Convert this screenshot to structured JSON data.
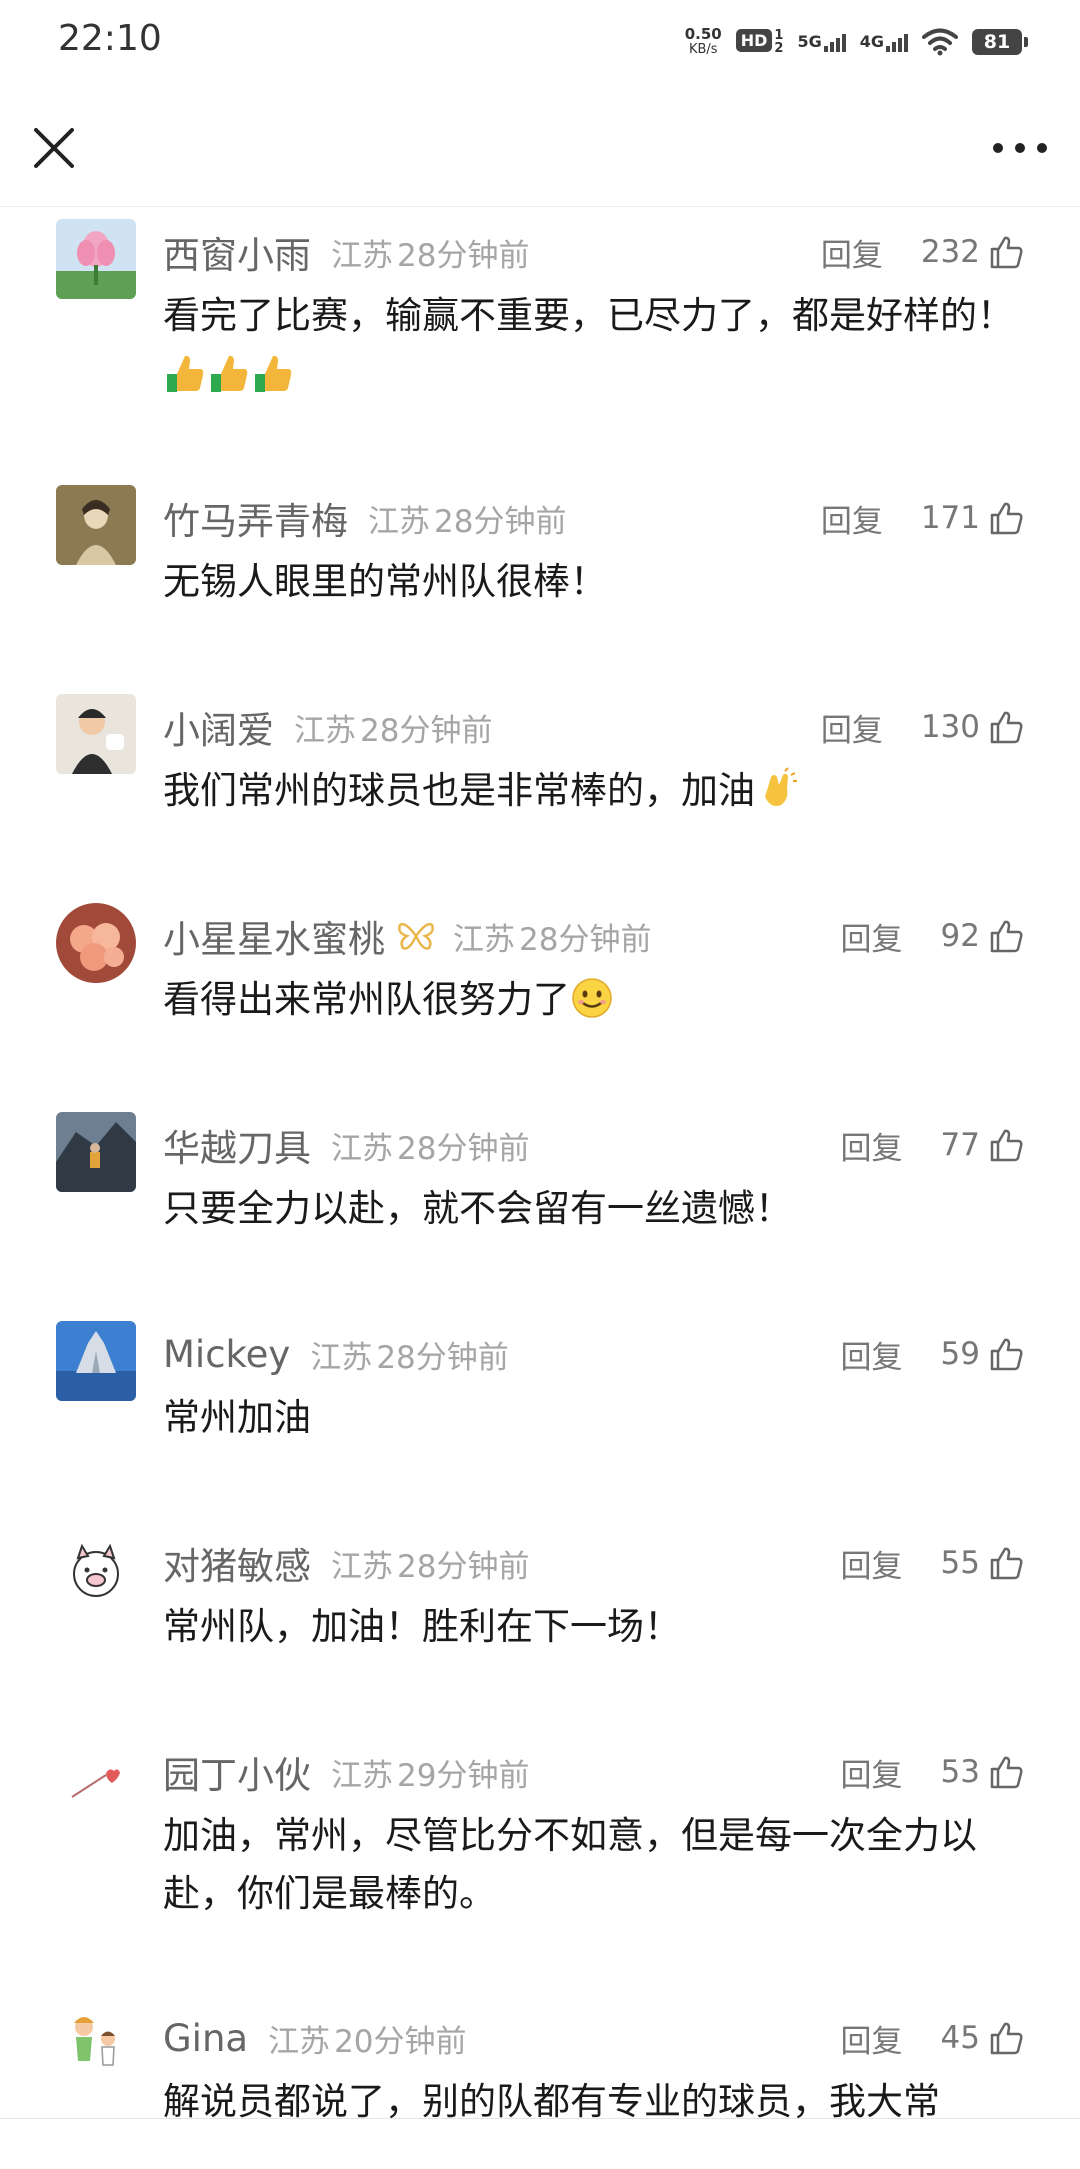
{
  "status_bar": {
    "time": "22:10",
    "speed_value": "0.50",
    "speed_unit": "KB/s",
    "hd_label": "HD",
    "hd_sub_top": "1",
    "hd_sub_bottom": "2",
    "net1_label": "5G",
    "net2_label": "4G",
    "battery": "81"
  },
  "comments": [
    {
      "name": "西窗小雨",
      "location": "江苏",
      "time": "28分钟前",
      "reply_label": "回复",
      "likes": "232",
      "text": "看完了比赛，输赢不重要，已尽力了，都是好样的！",
      "avatar_icon": "lotus-avatar",
      "emojis": [
        "thumbs-up-icon",
        "thumbs-up-icon",
        "thumbs-up-icon"
      ]
    },
    {
      "name": "竹马弄青梅",
      "location": "江苏",
      "time": "28分钟前",
      "reply_label": "回复",
      "likes": "171",
      "text": "无锡人眼里的常州队很棒！",
      "avatar_icon": "painting-avatar"
    },
    {
      "name": "小阔爱",
      "location": "江苏",
      "time": "28分钟前",
      "reply_label": "回复",
      "likes": "130",
      "text": "我们常州的球员也是非常棒的，加油",
      "avatar_icon": "child-avatar",
      "emojis": [
        "clapping-hands-icon"
      ]
    },
    {
      "name": "小星星水蜜桃",
      "location": "江苏",
      "time": "28分钟前",
      "reply_label": "回复",
      "likes": "92",
      "text": "看得出来常州队很努力了",
      "avatar_icon": "peach-avatar",
      "badge_icon": "butterfly-badge-icon",
      "emojis": [
        "smile-face-icon"
      ]
    },
    {
      "name": "华越刀具",
      "location": "江苏",
      "time": "28分钟前",
      "reply_label": "回复",
      "likes": "77",
      "text": "只要全力以赴，就不会留有一丝遗憾！",
      "avatar_icon": "rock-avatar"
    },
    {
      "name": "Mickey",
      "location": "江苏",
      "time": "28分钟前",
      "reply_label": "回复",
      "likes": "59",
      "text": "常州加油",
      "avatar_icon": "castle-avatar"
    },
    {
      "name": "对猪敏感",
      "location": "江苏",
      "time": "28分钟前",
      "reply_label": "回复",
      "likes": "55",
      "text": "常州队，加油！胜利在下一场！",
      "avatar_icon": "pig-avatar"
    },
    {
      "name": "园丁小伙",
      "location": "江苏",
      "time": "29分钟前",
      "reply_label": "回复",
      "likes": "53",
      "text": "加油，常州，尽管比分不如意，但是每一次全力以赴，你们是最棒的。",
      "avatar_icon": "heart-arrow-avatar"
    },
    {
      "name": "Gina",
      "location": "江苏",
      "time": "20分钟前",
      "reply_label": "回复",
      "likes": "45",
      "text": "解说员都说了，别的队都有专业的球员，我大常",
      "avatar_icon": "kids-avatar"
    }
  ]
}
